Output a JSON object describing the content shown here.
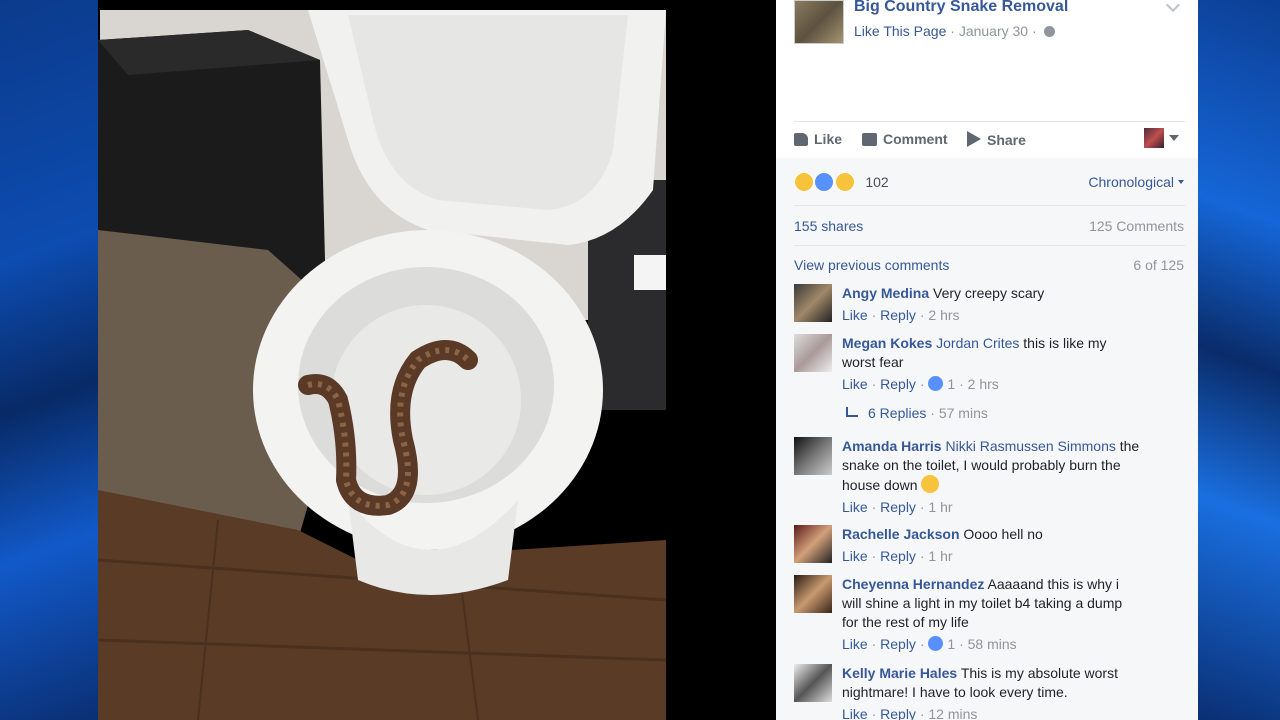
{
  "post": {
    "page_name": "Big Country Snake Removal",
    "like_page": "Like This Page",
    "date": "January 30"
  },
  "actions": {
    "like": "Like",
    "comment": "Comment",
    "share": "Share"
  },
  "reactions": {
    "count": "102",
    "order": "Chronological"
  },
  "stats": {
    "shares": "155 shares",
    "comments": "125 Comments"
  },
  "prev": {
    "label": "View previous comments",
    "count": "6 of 125"
  },
  "comments": [
    {
      "author": "Angy Medina",
      "tag": "",
      "text": "Very creepy scary",
      "like": "Like",
      "reply": "Reply",
      "likes": "",
      "time": "2 hrs"
    },
    {
      "author": "Megan Kokes",
      "tag": "Jordan Crites",
      "text": "this is like my worst fear",
      "like": "Like",
      "reply": "Reply",
      "likes": "1",
      "time": "2 hrs"
    },
    {
      "author": "Amanda Harris",
      "tag": "Nikki Rasmussen Simmons",
      "text": "the snake on the toilet, I would probably burn the house down",
      "like": "Like",
      "reply": "Reply",
      "likes": "",
      "time": "1 hr"
    },
    {
      "author": "Rachelle Jackson",
      "tag": "",
      "text": "Oooo hell no",
      "like": "Like",
      "reply": "Reply",
      "likes": "",
      "time": "1 hr"
    },
    {
      "author": "Cheyenna Hernandez",
      "tag": "",
      "text": "Aaaaand this is why i will shine a light in my toilet b4 taking a dump for the rest of my life",
      "like": "Like",
      "reply": "Reply",
      "likes": "1",
      "time": "58 mins"
    },
    {
      "author": "Kelly Marie Hales",
      "tag": "",
      "text": "This is my absolute worst nightmare! I have to look every time.",
      "like": "Like",
      "reply": "Reply",
      "likes": "",
      "time": "12 mins"
    }
  ],
  "replies": {
    "label": "6 Replies",
    "time": "57 mins"
  },
  "colors": {
    "link": "#365899",
    "meta": "#90949c",
    "frame": "#0b3a86"
  }
}
